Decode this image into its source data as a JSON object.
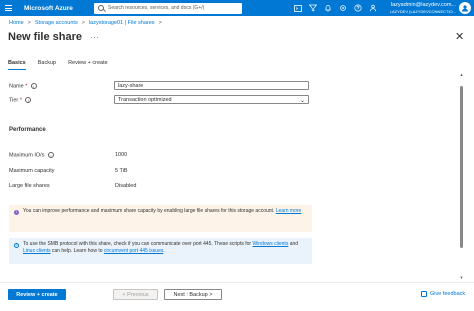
{
  "topbar": {
    "brand": "Microsoft Azure",
    "search_placeholder": "Search resources, services, and docs (G+/)",
    "account_email": "lazyadmin@lazydev.com...",
    "account_tenant": "LAZYDEV (LAZYDEVCONNECTIO..."
  },
  "breadcrumb": [
    "Home",
    "Storage accounts",
    "lazystorage01 | File shares"
  ],
  "page": {
    "title": "New file share",
    "more": "···"
  },
  "tabs": [
    {
      "label": "Basics",
      "active": true
    },
    {
      "label": "Backup",
      "active": false
    },
    {
      "label": "Review + create",
      "active": false
    }
  ],
  "form": {
    "name_label": "Name",
    "name_value": "lazy-share",
    "tier_label": "Tier",
    "tier_value": "Transaction optimized",
    "required_mark": "*"
  },
  "performance": {
    "title": "Performance",
    "max_iops_label": "Maximum IO/s",
    "max_iops_value": "1000",
    "max_capacity_label": "Maximum capacity",
    "max_capacity_value": "5 TiB",
    "large_file_label": "Large file shares",
    "large_file_value": "Disabled"
  },
  "banners": {
    "purple_text": "You can improve performance and maximum share capacity by enabling large file shares for this storage account.",
    "purple_link": "Learn more",
    "blue_text_1": "To use the SMB protocol with this share, check if you can communicate over port 445. These scripts for",
    "blue_link_1": "Windows clients",
    "blue_text_2": "and",
    "blue_link_2": "Linux clients",
    "blue_text_3": "can help. Learn how to",
    "blue_link_3": "circumvent port 445 issues",
    "blue_text_4": "."
  },
  "footer": {
    "primary": "Review + create",
    "previous": "< Previous",
    "next": "Next : Backup >",
    "feedback": "Give feedback"
  },
  "colors": {
    "accent": "#0078d4",
    "purple_banner_bg": "#fdf3e9",
    "blue_banner_bg": "#eaf3fc"
  }
}
